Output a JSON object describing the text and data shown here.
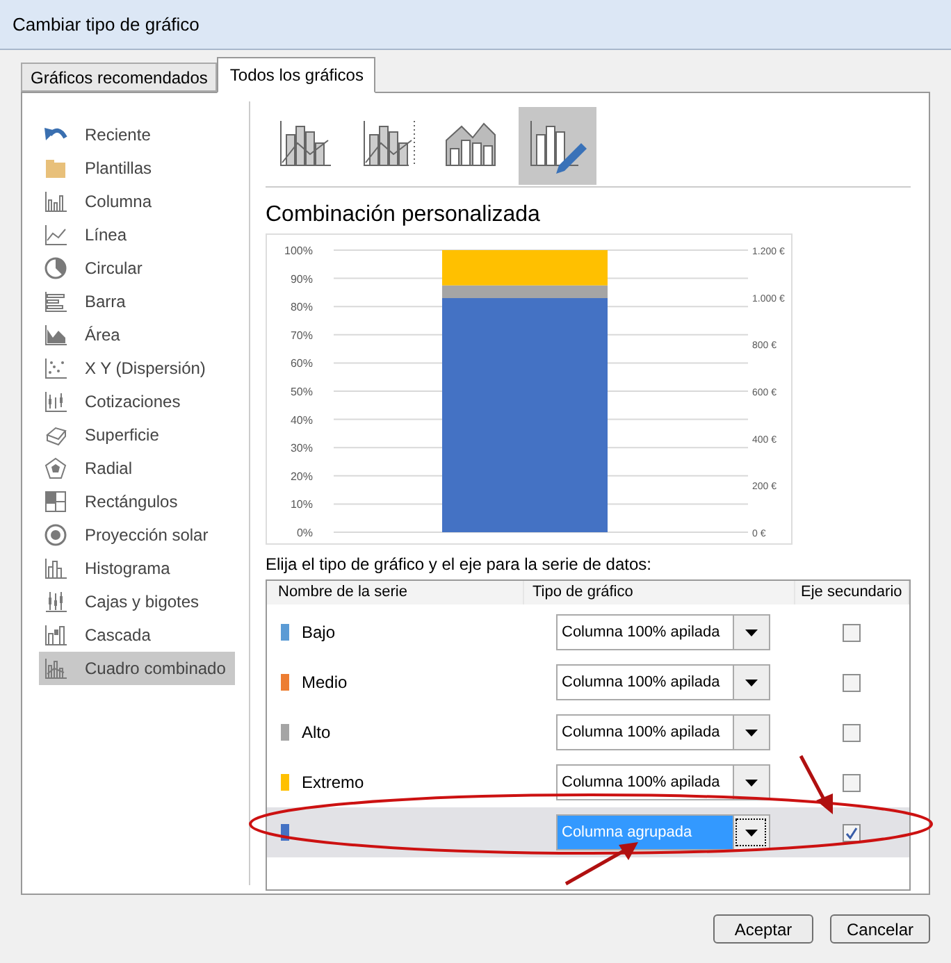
{
  "window": {
    "title": "Cambiar tipo de gráfico"
  },
  "tabs": [
    {
      "label": "Gráficos recomendados",
      "selected": false
    },
    {
      "label": "Todos los gráficos",
      "selected": true
    }
  ],
  "sidebar": {
    "items": [
      {
        "label": "Reciente",
        "selected": false
      },
      {
        "label": "Plantillas",
        "selected": false
      },
      {
        "label": "Columna",
        "selected": false
      },
      {
        "label": "Línea",
        "selected": false
      },
      {
        "label": "Circular",
        "selected": false
      },
      {
        "label": "Barra",
        "selected": false
      },
      {
        "label": "Área",
        "selected": false
      },
      {
        "label": "X Y (Dispersión)",
        "selected": false
      },
      {
        "label": "Cotizaciones",
        "selected": false
      },
      {
        "label": "Superficie",
        "selected": false
      },
      {
        "label": "Radial",
        "selected": false
      },
      {
        "label": "Rectángulos",
        "selected": false
      },
      {
        "label": "Proyección solar",
        "selected": false
      },
      {
        "label": "Histograma",
        "selected": false
      },
      {
        "label": "Cajas y bigotes",
        "selected": false
      },
      {
        "label": "Cascada",
        "selected": false
      },
      {
        "label": "Cuadro combinado",
        "selected": true
      }
    ]
  },
  "subtypes": [
    {
      "selected": false
    },
    {
      "selected": false
    },
    {
      "selected": false
    },
    {
      "selected": true
    }
  ],
  "preview": {
    "title": "Combinación personalizada",
    "chart_data": {
      "type": "bar",
      "stacked": true,
      "grid": true,
      "categories": [
        null
      ],
      "series": [
        {
          "color": "#4472c4",
          "values": [
            83
          ]
        },
        {
          "color": "#ed7d31",
          "values": [
            0
          ]
        },
        {
          "color": "#a5a5a5",
          "values": [
            4.5
          ]
        },
        {
          "color": "#ffc000",
          "values": [
            12.5
          ]
        }
      ],
      "ylim": [
        0,
        100
      ],
      "yticks": [
        {
          "value": 0,
          "label": "0%"
        },
        {
          "value": 10,
          "label": "10%"
        },
        {
          "value": 20,
          "label": "20%"
        },
        {
          "value": 30,
          "label": "30%"
        },
        {
          "value": 40,
          "label": "40%"
        },
        {
          "value": 50,
          "label": "50%"
        },
        {
          "value": 60,
          "label": "60%"
        },
        {
          "value": 70,
          "label": "70%"
        },
        {
          "value": 80,
          "label": "80%"
        },
        {
          "value": 90,
          "label": "90%"
        },
        {
          "value": 100,
          "label": "100%"
        }
      ]
    },
    "secondary_axis_labels": [
      "1.200 €",
      "1.000 €",
      "800 €",
      "600 €",
      "400 €",
      "200 €",
      "0 €"
    ]
  },
  "series_table": {
    "instruction": "Elija el tipo de gráfico y el eje para la serie de datos:",
    "columns": [
      "Nombre de la serie",
      "Tipo de gráfico",
      "Eje secundario"
    ],
    "rows": [
      {
        "name": "Bajo",
        "color": "#5b9bd5",
        "chart_type": "Columna 100% apilada",
        "secondary_axis": false,
        "selected": false
      },
      {
        "name": "Medio",
        "color": "#ed7d31",
        "chart_type": "Columna 100% apilada",
        "secondary_axis": false,
        "selected": false
      },
      {
        "name": "Alto",
        "color": "#a5a5a5",
        "chart_type": "Columna 100% apilada",
        "secondary_axis": false,
        "selected": false
      },
      {
        "name": "Extremo",
        "color": "#ffc000",
        "chart_type": "Columna 100% apilada",
        "secondary_axis": false,
        "selected": false
      },
      {
        "color": "#4472c4",
        "chart_type": "Columna agrupada",
        "secondary_axis": true,
        "selected": true
      }
    ]
  },
  "buttons": [
    "Aceptar",
    "Cancelar"
  ]
}
